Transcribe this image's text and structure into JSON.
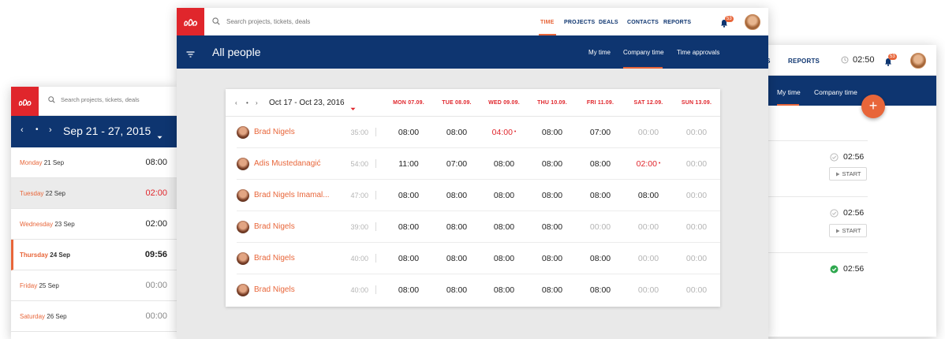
{
  "brand": {
    "logo_color": "#e0262c",
    "navy": "#0e3570",
    "accent": "#e8663a"
  },
  "right_window": {
    "nav": [
      "CTS",
      "REPORTS"
    ],
    "clock": "02:50",
    "notification_count": "53",
    "tabs": [
      "My time",
      "Company time"
    ],
    "fab_label": "+",
    "entries": [
      {
        "time": "02:56",
        "status": "idle",
        "button": "START"
      },
      {
        "time": "02:56",
        "status": "idle",
        "button": "START"
      },
      {
        "time": "02:56",
        "status": "done"
      }
    ]
  },
  "left_window": {
    "search_placeholder": "Search projects, tickets, deals",
    "range": "Sep 21 - 27, 2015",
    "days": [
      {
        "name": "Monday",
        "date": "21 Sep",
        "value": "08:00",
        "state": "normal"
      },
      {
        "name": "Tuesday",
        "date": "22 Sep",
        "value": "02:00",
        "state": "warn"
      },
      {
        "name": "Wednesday",
        "date": "23 Sep",
        "value": "02:00",
        "state": "normal"
      },
      {
        "name": "Thursday",
        "date": "24 Sep",
        "value": "09:56",
        "state": "today"
      },
      {
        "name": "Friday",
        "date": "25 Sep",
        "value": "00:00",
        "state": "muted"
      },
      {
        "name": "Saturday",
        "date": "26 Sep",
        "value": "00:00",
        "state": "muted"
      }
    ]
  },
  "main_window": {
    "search_placeholder": "Search projects, tickets, deals",
    "nav": [
      "TIME",
      "PROJECTS",
      "DEALS",
      "CONTACTS",
      "REPORTS"
    ],
    "notification_count": "53",
    "title": "All people",
    "tabs": [
      "My time",
      "Company time",
      "Time approvals"
    ],
    "range": "Oct 17 - Oct 23, 2016",
    "day_headers": [
      "MON 07.09.",
      "TUE 08.09.",
      "WED 09.09.",
      "THU 10.09.",
      "FRI 11.09.",
      "SAT 12.09.",
      "SUN 13.09."
    ],
    "rows": [
      {
        "name": "Brad Nigels",
        "total": "35:00",
        "cells": [
          "08:00",
          "08:00",
          "04:00",
          "08:00",
          "07:00",
          "00:00",
          "00:00"
        ],
        "states": [
          "n",
          "n",
          "r",
          "n",
          "n",
          "m",
          "m"
        ]
      },
      {
        "name": "Adis Mustedanagić",
        "total": "54:00",
        "cells": [
          "11:00",
          "07:00",
          "08:00",
          "08:00",
          "08:00",
          "02:00",
          "00:00"
        ],
        "states": [
          "n",
          "n",
          "n",
          "n",
          "n",
          "r",
          "m"
        ]
      },
      {
        "name": "Brad Nigels Imamal...",
        "total": "47:00",
        "cells": [
          "08:00",
          "08:00",
          "08:00",
          "08:00",
          "08:00",
          "08:00",
          "00:00"
        ],
        "states": [
          "n",
          "n",
          "n",
          "n",
          "n",
          "n",
          "m"
        ]
      },
      {
        "name": "Brad Nigels",
        "total": "39:00",
        "cells": [
          "08:00",
          "08:00",
          "08:00",
          "08:00",
          "00:00",
          "00:00",
          "00:00"
        ],
        "states": [
          "n",
          "n",
          "n",
          "n",
          "m",
          "m",
          "m"
        ]
      },
      {
        "name": "Brad Nigels",
        "total": "40:00",
        "cells": [
          "08:00",
          "08:00",
          "08:00",
          "08:00",
          "08:00",
          "00:00",
          "00:00"
        ],
        "states": [
          "n",
          "n",
          "n",
          "n",
          "n",
          "m",
          "m"
        ]
      },
      {
        "name": "Brad Nigels",
        "total": "40:00",
        "cells": [
          "08:00",
          "08:00",
          "08:00",
          "08:00",
          "08:00",
          "00:00",
          "00:00"
        ],
        "states": [
          "n",
          "n",
          "n",
          "n",
          "n",
          "m",
          "m"
        ]
      }
    ]
  }
}
